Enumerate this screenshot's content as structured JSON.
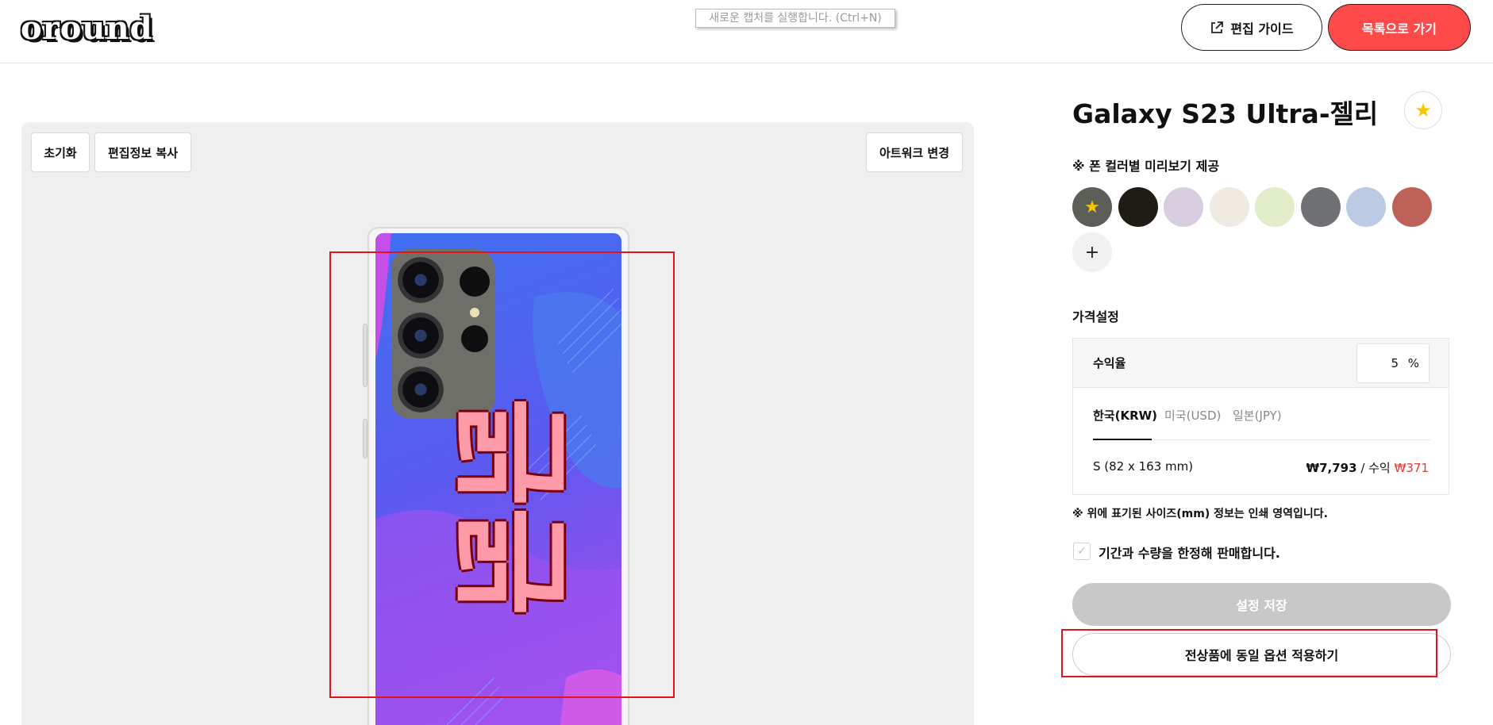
{
  "header": {
    "logo": "oround",
    "capture_hint": "새로운 캡처를 실행합니다. (Ctrl+N)",
    "guide_label": "편집 가이드",
    "guide_icon": "external-link-icon",
    "back_label": "목록으로 가기",
    "back_color": "#ff4a4a"
  },
  "editor": {
    "reset_label": "초기화",
    "copy_label": "편집정보 복사",
    "change_artwork_label": "아트워크 변경",
    "artwork_text": "긁긁",
    "highlight_color": "#e0141e"
  },
  "product": {
    "title": "Galaxy S23 Ultra-젤리",
    "favorite_icon": "star-icon",
    "preview_label": "※ 폰 컬러별 미리보기 제공",
    "swatches": [
      {
        "color": "#5b5f57",
        "selected": true
      },
      {
        "color": "#1f1c16"
      },
      {
        "color": "#d9cde0"
      },
      {
        "color": "#efebe2"
      },
      {
        "color": "#e1ecc9"
      },
      {
        "color": "#6f7175"
      },
      {
        "color": "#bccbe3"
      },
      {
        "color": "#bd6159"
      }
    ],
    "add_color": "+"
  },
  "pricing": {
    "section_label": "가격설정",
    "margin_label": "수익율",
    "margin_value": "5",
    "margin_unit": "%",
    "tabs": [
      "한국(KRW)",
      "미국(USD)",
      "일본(JPY)"
    ],
    "active_tab": "한국(KRW)",
    "size": "S (82 x 163 mm)",
    "price": "₩7,793",
    "profit_prefix": "/ 수익",
    "profit": "₩371",
    "profit_color": "#e33b3b"
  },
  "notes": {
    "size_note": "※ 위에 표기된 사이즈(mm) 정보는 인쇄 영역입니다.",
    "limited_label": "기간과 수량을 한정해 판매합니다.",
    "limited_checked": false
  },
  "actions": {
    "save_label": "설정 저장",
    "apply_all_label": "전상품에 동일 옵션 적용하기"
  }
}
